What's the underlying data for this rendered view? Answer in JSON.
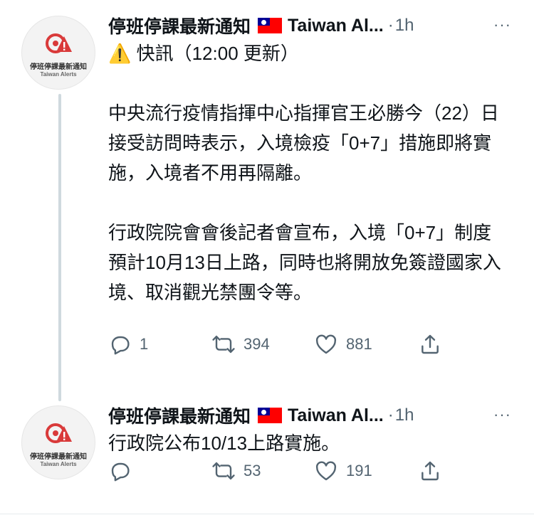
{
  "tweets": [
    {
      "avatar": {
        "name_cn": "停班停課最新通知",
        "name_en": "Taiwan Alerts"
      },
      "display_name": "停班停課最新通知",
      "flag": "taiwan-flag-icon",
      "handle_name": "Taiwan Al...",
      "separator": "·",
      "time": "1h",
      "more": "···",
      "text": "⚠️ 快訊（12:00 更新）\n\n中央流行疫情指揮中心指揮官王必勝今（22）日接受訪問時表示，入境檢疫「0+7」措施即將實施，入境者不用再隔離。\n\n行政院院會會後記者會宣布，入境「0+7」制度預計10月13日上路，同時也將開放免簽證國家入境、取消觀光禁團令等。",
      "actions": {
        "reply": "1",
        "retweet": "394",
        "like": "881",
        "share": ""
      }
    },
    {
      "avatar": {
        "name_cn": "停班停課最新通知",
        "name_en": "Taiwan Alerts"
      },
      "display_name": "停班停課最新通知",
      "flag": "taiwan-flag-icon",
      "handle_name": "Taiwan Al...",
      "separator": "·",
      "time": "1h",
      "more": "···",
      "text": "行政院公布10/13上路實施。",
      "actions": {
        "reply": "",
        "retweet": "53",
        "like": "191",
        "share": ""
      }
    }
  ],
  "colors": {
    "text": "#0f1419",
    "muted": "#536471",
    "thread_line": "#cfd9de",
    "logo_red": "#d93a3a"
  }
}
